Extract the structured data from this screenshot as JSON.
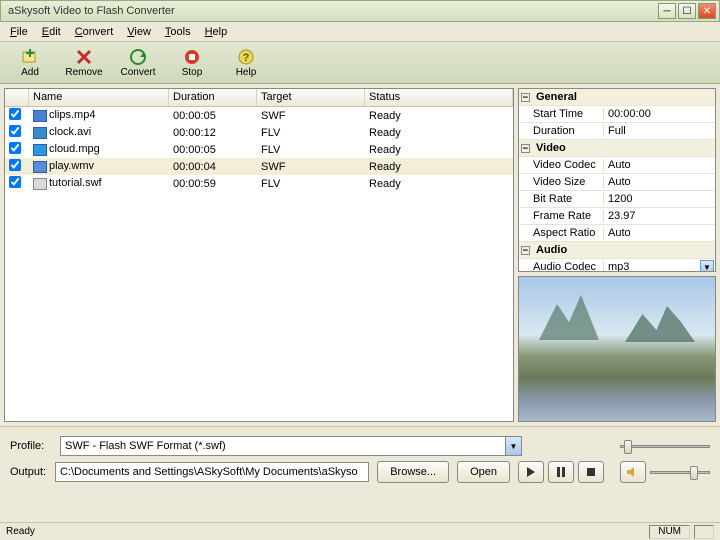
{
  "title": "aSkysoft Video to Flash Converter",
  "menu": [
    "File",
    "Edit",
    "Convert",
    "View",
    "Tools",
    "Help"
  ],
  "toolbar": [
    {
      "name": "add",
      "label": "Add"
    },
    {
      "name": "remove",
      "label": "Remove"
    },
    {
      "name": "convert",
      "label": "Convert"
    },
    {
      "name": "stop",
      "label": "Stop"
    },
    {
      "name": "help",
      "label": "Help"
    }
  ],
  "columns": {
    "name": "Name",
    "duration": "Duration",
    "target": "Target",
    "status": "Status"
  },
  "files": [
    {
      "checked": true,
      "icon": "mp4",
      "name": "clips.mp4",
      "duration": "00:00:05",
      "target": "SWF",
      "status": "Ready",
      "sel": false
    },
    {
      "checked": true,
      "icon": "avi",
      "name": "clock.avi",
      "duration": "00:00:12",
      "target": "FLV",
      "status": "Ready",
      "sel": false
    },
    {
      "checked": true,
      "icon": "mpg",
      "name": "cloud.mpg",
      "duration": "00:00:05",
      "target": "FLV",
      "status": "Ready",
      "sel": false
    },
    {
      "checked": true,
      "icon": "wmv",
      "name": "play.wmv",
      "duration": "00:00:04",
      "target": "SWF",
      "status": "Ready",
      "sel": true
    },
    {
      "checked": true,
      "icon": "swf",
      "name": "tutorial.swf",
      "duration": "00:00:59",
      "target": "FLV",
      "status": "Ready",
      "sel": false
    }
  ],
  "props": {
    "groups": [
      {
        "title": "General",
        "items": [
          {
            "k": "Start Time",
            "v": "00:00:00"
          },
          {
            "k": "Duration",
            "v": "Full"
          }
        ]
      },
      {
        "title": "Video",
        "items": [
          {
            "k": "Video Codec",
            "v": "Auto"
          },
          {
            "k": "Video Size",
            "v": "Auto"
          },
          {
            "k": "Bit Rate",
            "v": "1200"
          },
          {
            "k": "Frame Rate",
            "v": "23.97"
          },
          {
            "k": "Aspect Ratio",
            "v": "Auto"
          }
        ]
      },
      {
        "title": "Audio",
        "items": [
          {
            "k": "Audio Codec",
            "v": "mp3",
            "dd": true
          }
        ]
      }
    ]
  },
  "profile": {
    "label": "Profile:",
    "value": "SWF - Flash SWF Format (*.swf)"
  },
  "output": {
    "label": "Output:",
    "value": "C:\\Documents and Settings\\ASkySoft\\My Documents\\aSkyso"
  },
  "buttons": {
    "browse": "Browse...",
    "open": "Open"
  },
  "status": {
    "ready": "Ready",
    "num": "NUM"
  }
}
